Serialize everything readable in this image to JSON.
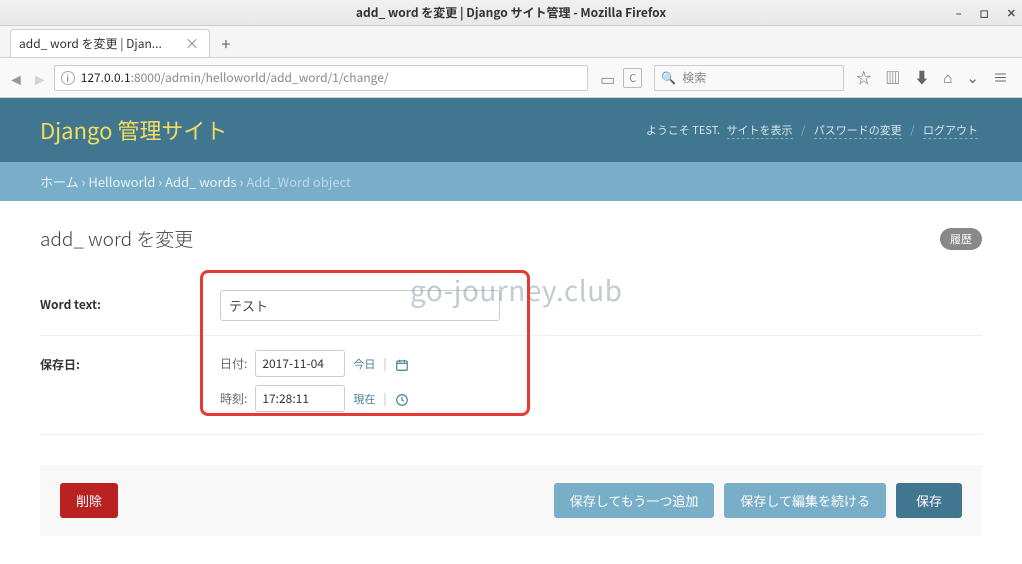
{
  "window": {
    "title": "add_ word を変更 | Django サイト管理 - Mozilla Firefox"
  },
  "tab": {
    "title": "add_ word を変更 | Djan..."
  },
  "addr": {
    "host": "127.0.0.1",
    "port": ":8000",
    "path": "/admin/helloworld/add_word/1/change/"
  },
  "search": {
    "placeholder": "検索"
  },
  "django": {
    "brand": "Django 管理サイト"
  },
  "user": {
    "welcome": "ようこそ TEST.",
    "view_site": "サイトを表示",
    "change_pw": "パスワードの変更",
    "logout": "ログアウト"
  },
  "crumbs": {
    "home": "ホーム",
    "app": "Helloworld",
    "model": "Add_ words",
    "obj": "Add_Word object"
  },
  "page": {
    "h1": "add_ word を変更",
    "history": "履歴"
  },
  "form": {
    "word_label": "Word text:",
    "word_value": "テスト",
    "date_group_label": "保存日:",
    "date_label": "日付:",
    "date_value": "2017-11-04",
    "today": "今日",
    "time_label": "時刻:",
    "time_value": "17:28:11",
    "now": "現在"
  },
  "buttons": {
    "delete": "削除",
    "save_add": "保存してもう一つ追加",
    "save_cont": "保存して編集を続ける",
    "save": "保存"
  },
  "watermark": "go-journey.club"
}
